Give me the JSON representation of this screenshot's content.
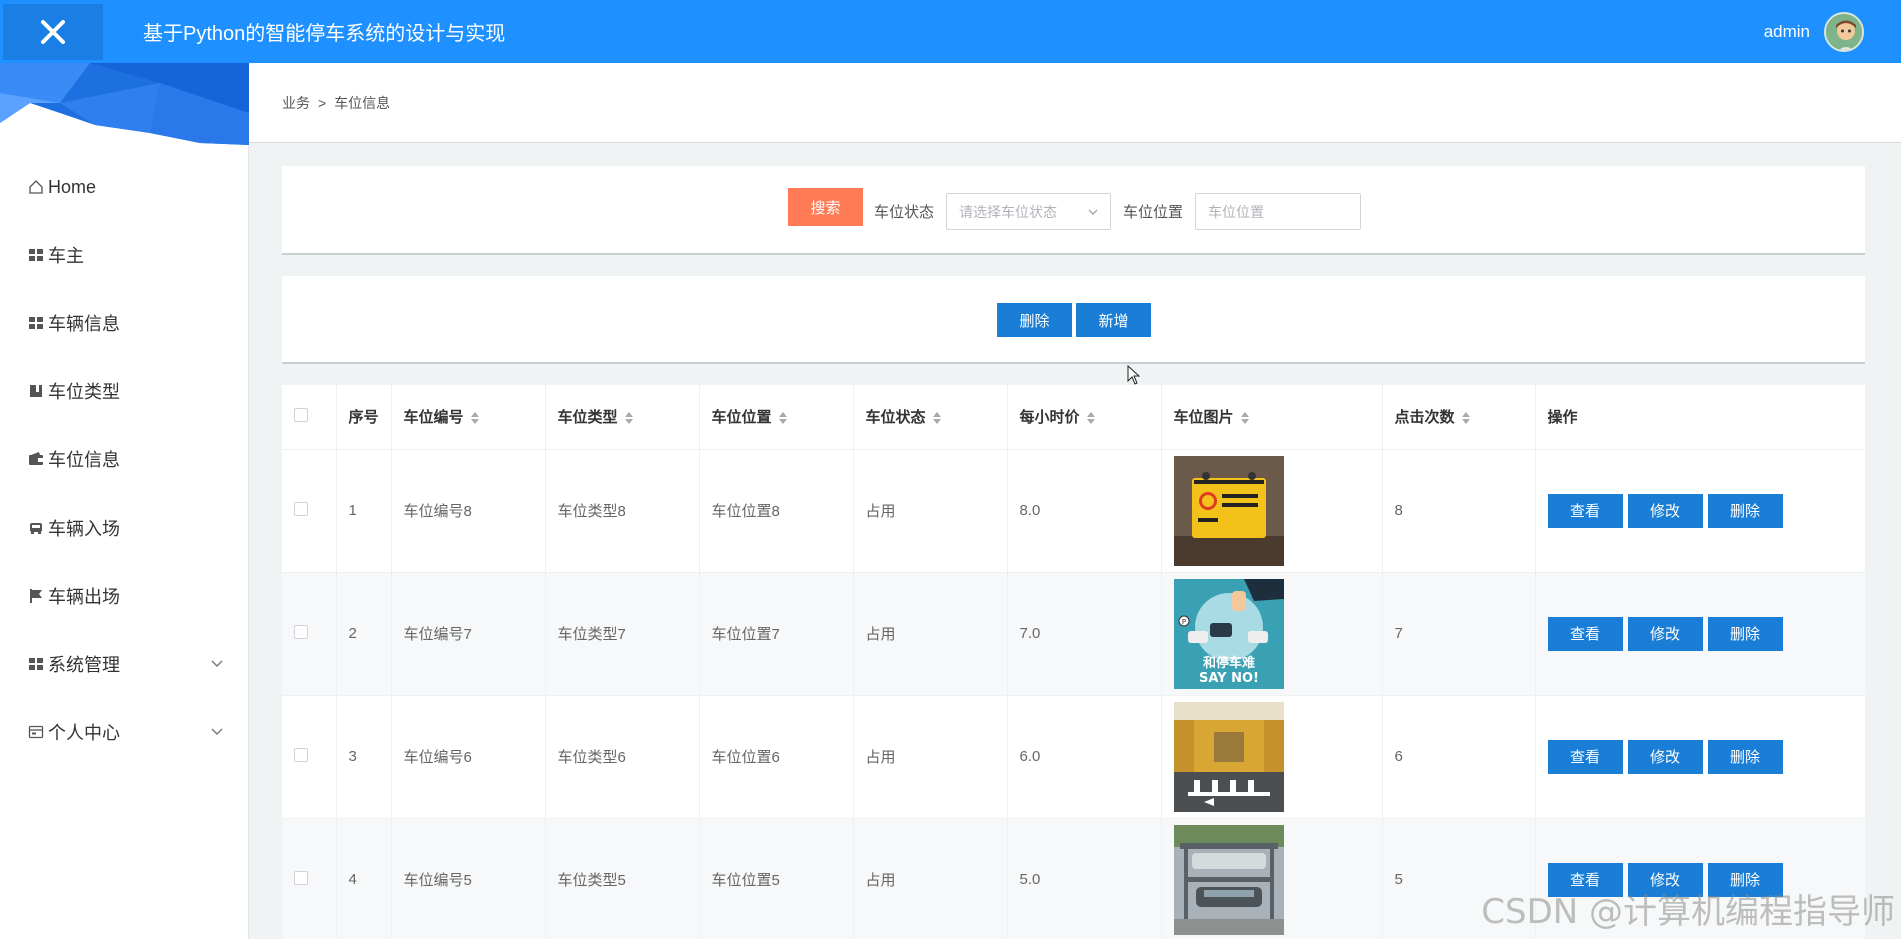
{
  "header": {
    "title": "基于Python的智能停车系统的设计与实现",
    "username": "admin",
    "brand_color": "#1e90ff"
  },
  "sidebar": {
    "items": [
      {
        "label": "Home",
        "icon": "home-icon"
      },
      {
        "label": "车主",
        "icon": "grid-icon"
      },
      {
        "label": "车辆信息",
        "icon": "grid-icon"
      },
      {
        "label": "车位类型",
        "icon": "bookmark-icon"
      },
      {
        "label": "车位信息",
        "icon": "wallet-icon"
      },
      {
        "label": "车辆入场",
        "icon": "car-icon"
      },
      {
        "label": "车辆出场",
        "icon": "flag-icon"
      },
      {
        "label": "系统管理",
        "icon": "grid-icon",
        "expandable": true
      },
      {
        "label": "个人中心",
        "icon": "card-icon",
        "expandable": true
      }
    ]
  },
  "breadcrumb": {
    "parent": "业务",
    "separator": ">",
    "current": "车位信息"
  },
  "search": {
    "button_label": "搜索",
    "status_label": "车位状态",
    "status_placeholder": "请选择车位状态",
    "location_label": "车位位置",
    "location_placeholder": "车位位置"
  },
  "actions": {
    "delete_label": "删除",
    "add_label": "新增"
  },
  "table": {
    "headers": {
      "index": "序号",
      "code": "车位编号",
      "type": "车位类型",
      "location": "车位位置",
      "status": "车位状态",
      "price": "每小时价",
      "image": "车位图片",
      "clicks": "点击次数",
      "ops": "操作"
    },
    "op_labels": {
      "view": "查看",
      "edit": "修改",
      "delete": "删除"
    },
    "rows": [
      {
        "index": "1",
        "code": "车位编号8",
        "type": "车位类型8",
        "location": "车位位置8",
        "status": "占用",
        "price": "8.0",
        "clicks": "8",
        "image_name": "no-parking-sign-image"
      },
      {
        "index": "2",
        "code": "车位编号7",
        "type": "车位类型7",
        "location": "车位位置7",
        "status": "占用",
        "price": "7.0",
        "clicks": "7",
        "image_name": "parking-illustration-image",
        "image_text_1": "和停车难",
        "image_text_2": "SAY NO!"
      },
      {
        "index": "3",
        "code": "车位编号6",
        "type": "车位类型6",
        "location": "车位位置6",
        "status": "占用",
        "price": "6.0",
        "clicks": "6",
        "image_name": "garage-photo-image"
      },
      {
        "index": "4",
        "code": "车位编号5",
        "type": "车位类型5",
        "location": "车位位置5",
        "status": "占用",
        "price": "5.0",
        "clicks": "5",
        "image_name": "stacked-parking-photo-image"
      }
    ]
  },
  "watermark": "CSDN @计算机编程指导师"
}
